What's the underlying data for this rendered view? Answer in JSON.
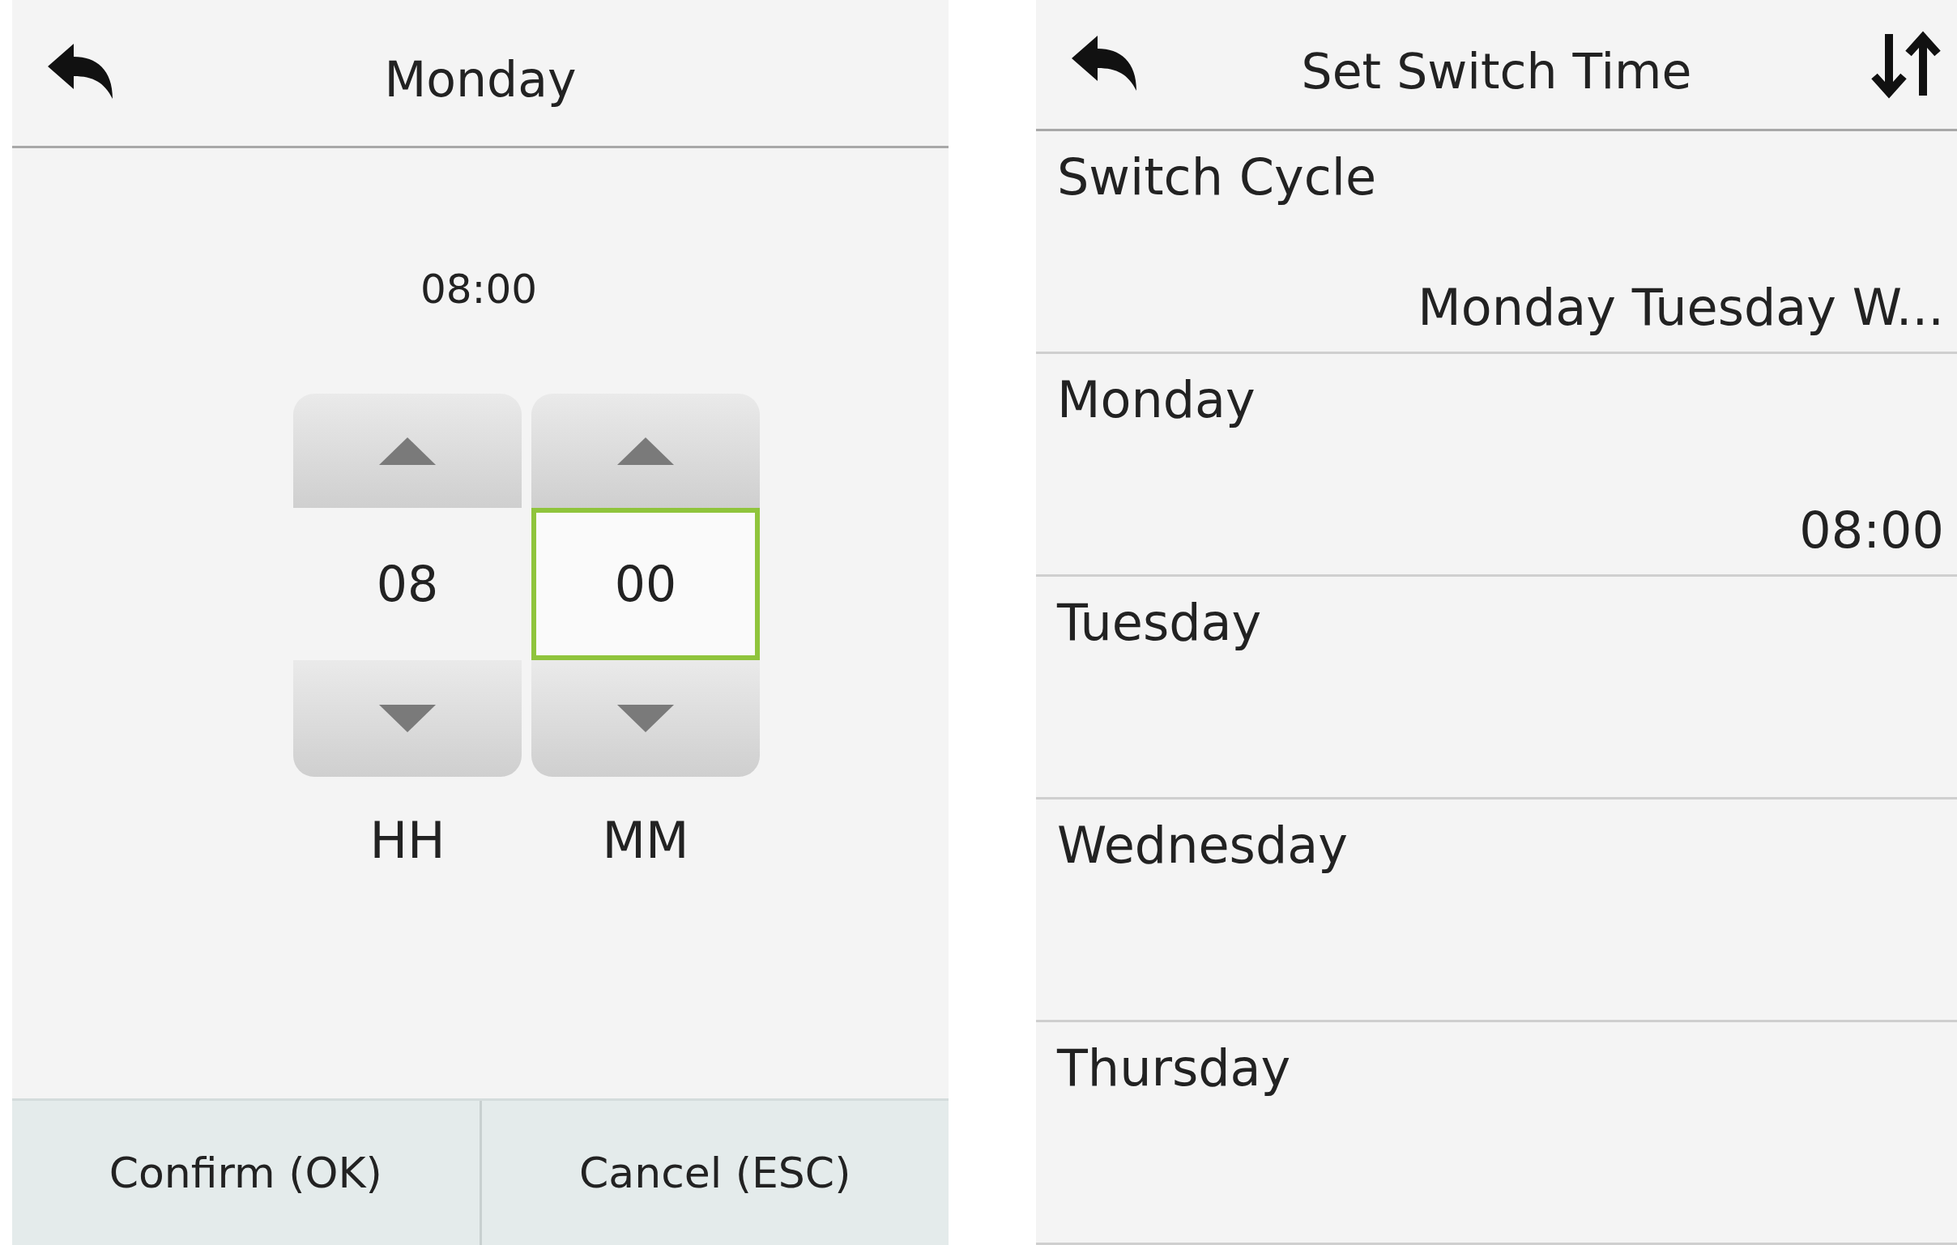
{
  "screens": [
    {
      "kind": "time-picker",
      "title": "Monday",
      "time": "08:00",
      "fields": [
        {
          "value": "08",
          "label": "HH",
          "selected": false
        },
        {
          "value": "00",
          "label": "MM",
          "selected": true
        }
      ],
      "buttons": [
        "Confirm (OK)",
        "Cancel (ESC)"
      ]
    },
    {
      "kind": "list",
      "title": "Set Switch Time",
      "rows": [
        {
          "label": "Switch Cycle",
          "value": "Monday Tuesday W..."
        },
        {
          "label": "Monday",
          "value": "08:00"
        },
        {
          "label": "Tuesday"
        },
        {
          "label": "Wednesday"
        },
        {
          "label": "Thursday"
        }
      ]
    }
  ]
}
